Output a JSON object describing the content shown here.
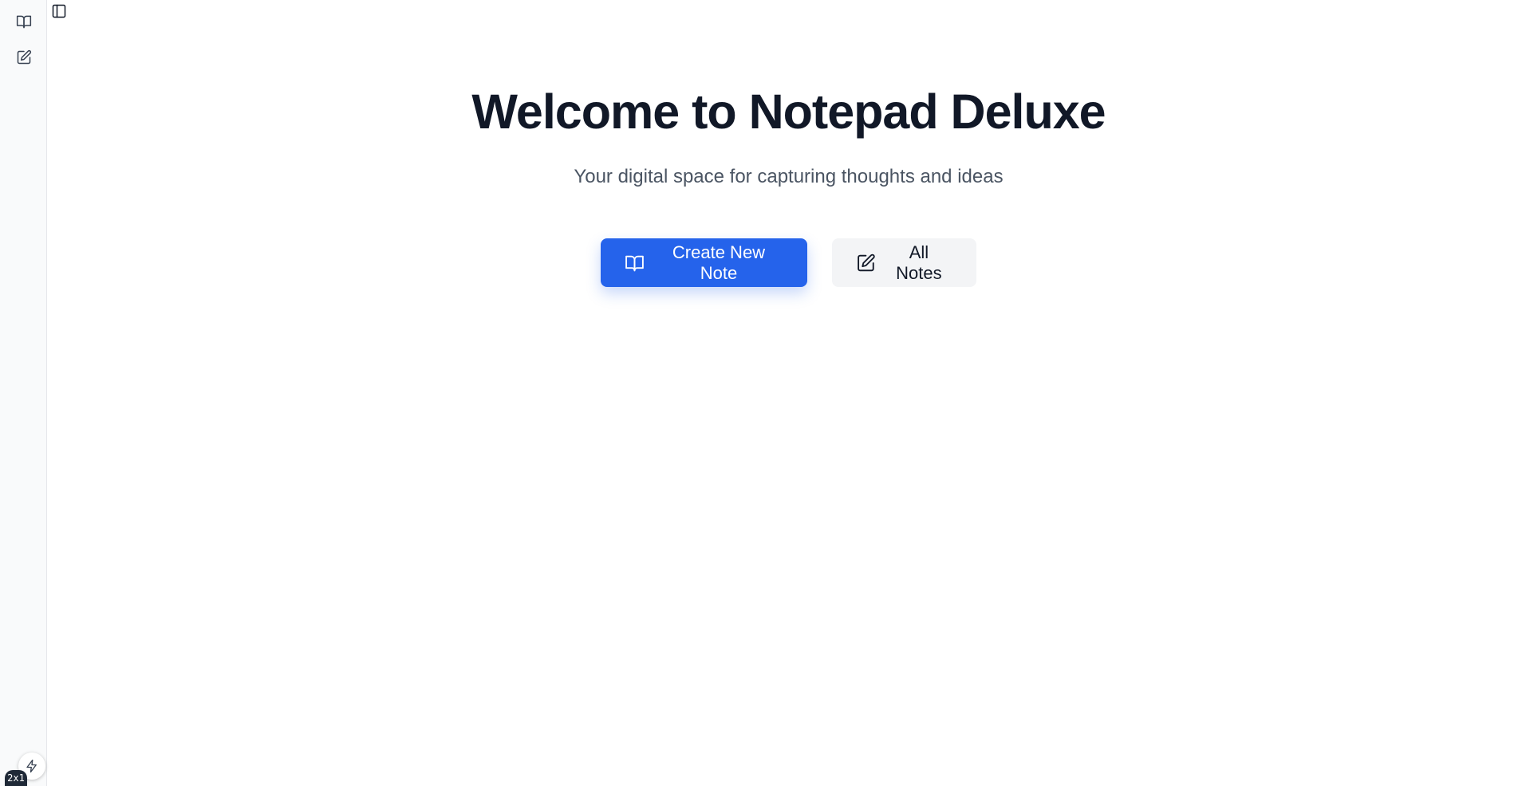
{
  "sidebar": {
    "items": [
      {
        "icon": "book-open-icon"
      },
      {
        "icon": "edit-icon"
      }
    ],
    "toggle_icon": "sidebar-toggle-icon"
  },
  "main": {
    "title": "Welcome to Notepad Deluxe",
    "subtitle": "Your digital space for capturing thoughts and ideas",
    "primary_button": {
      "label": "Create New Note",
      "icon": "book-open-icon"
    },
    "secondary_button": {
      "label": "All Notes",
      "icon": "edit-icon"
    }
  },
  "footer": {
    "bolt_icon": "lightning-icon",
    "zoom_label": "2x1"
  },
  "colors": {
    "accent": "#2563eb",
    "title": "#111827",
    "subtitle": "#4b5563",
    "secondary_bg": "#f3f4f6"
  }
}
